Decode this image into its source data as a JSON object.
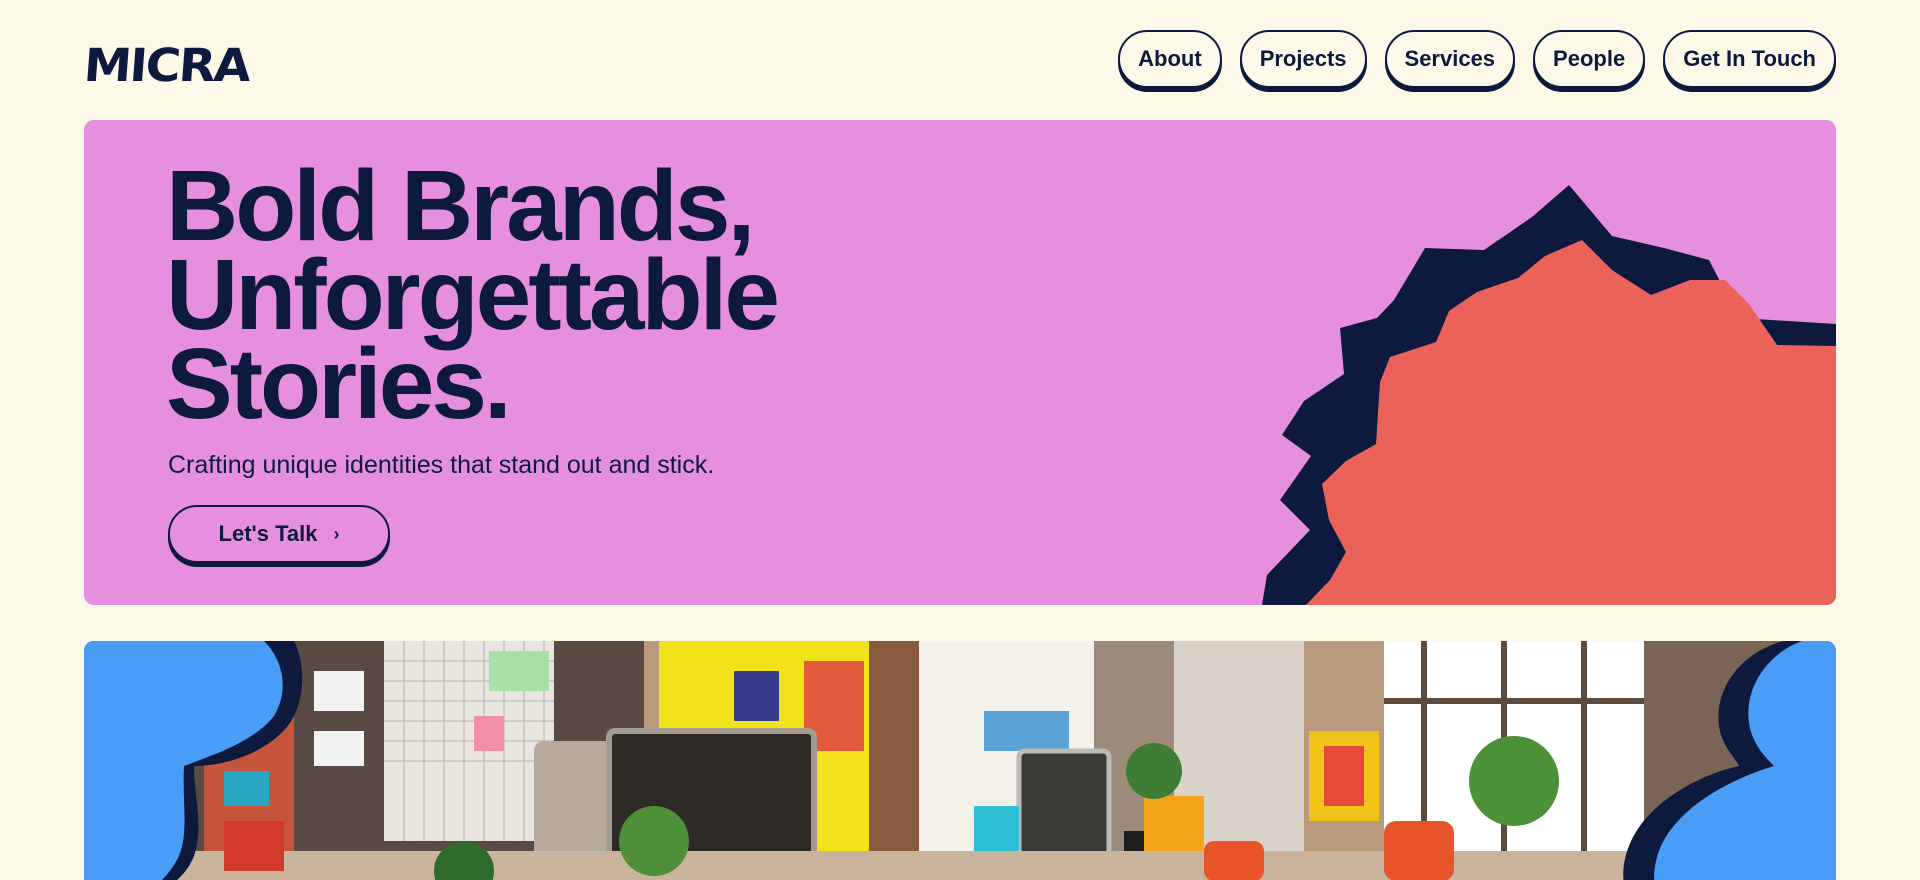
{
  "brand": {
    "name": "MICRA"
  },
  "nav": {
    "items": [
      {
        "label": "About"
      },
      {
        "label": "Projects"
      },
      {
        "label": "Services"
      },
      {
        "label": "People"
      },
      {
        "label": "Get In Touch"
      }
    ]
  },
  "hero": {
    "headline_lines": [
      "Bold Brands,",
      "Unforgettable",
      "Stories."
    ],
    "subtitle": "Crafting unique identities that stand out and stick.",
    "cta_label": "Let's Talk",
    "cta_icon": "chevron-right-icon"
  },
  "colors": {
    "background": "#fdf9e8",
    "navy": "#0d1a3d",
    "hero_pink": "#e68fdf",
    "burst_coral": "#eb625a",
    "cloud_blue": "#4a9df7"
  },
  "photo": {
    "icon": "office-photo"
  }
}
